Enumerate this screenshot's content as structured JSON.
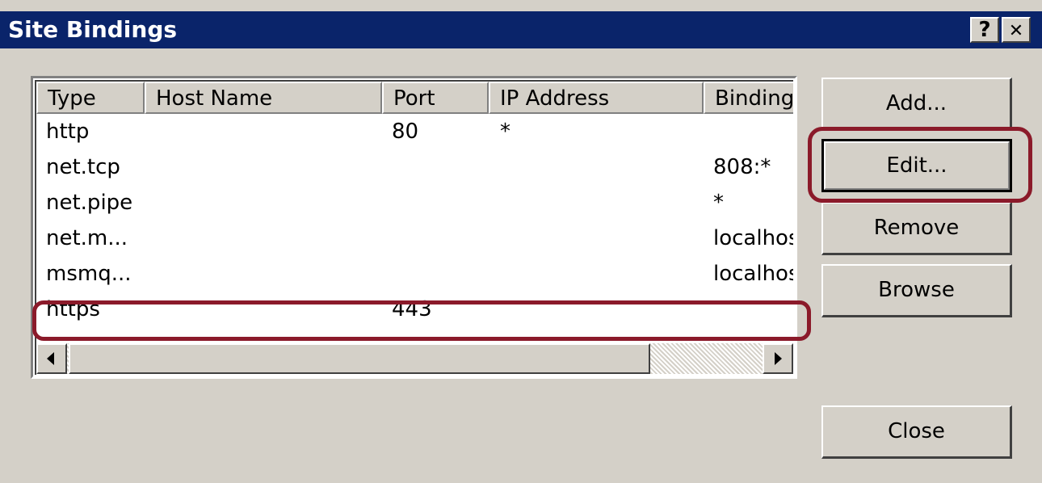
{
  "window": {
    "title": "Site Bindings"
  },
  "titlebar_buttons": [
    {
      "name": "help",
      "glyph": "?"
    },
    {
      "name": "close",
      "glyph": "✕"
    }
  ],
  "list": {
    "columns": [
      "Type",
      "Host Name",
      "Port",
      "IP Address",
      "Binding"
    ],
    "rows": [
      {
        "type": "http",
        "host": "",
        "port": "80",
        "ip": "*",
        "binding": ""
      },
      {
        "type": "net.tcp",
        "host": "",
        "port": "",
        "ip": "",
        "binding": "808:*"
      },
      {
        "type": "net.pipe",
        "host": "",
        "port": "",
        "ip": "",
        "binding": "*"
      },
      {
        "type": "net.m...",
        "host": "",
        "port": "",
        "ip": "",
        "binding": "localhos"
      },
      {
        "type": "msmq...",
        "host": "",
        "port": "",
        "ip": "",
        "binding": "localhos"
      },
      {
        "type": "https",
        "host": "",
        "port": "443",
        "ip": "",
        "binding": ""
      }
    ]
  },
  "buttons": {
    "add": "Add...",
    "edit": "Edit...",
    "remove": "Remove",
    "browse": "Browse",
    "close": "Close"
  },
  "highlight_color": "#8b1a2a"
}
